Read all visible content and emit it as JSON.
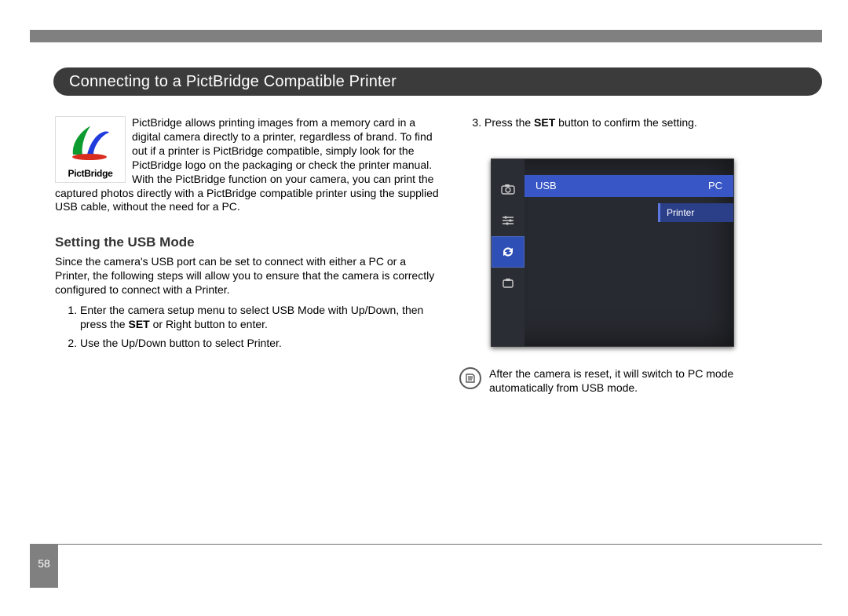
{
  "page_title": "Connecting to a PictBridge Compatible Printer",
  "pictbridge_label": "PictBridge",
  "intro": "PictBridge allows printing images from a memory card in a digital camera directly to a printer, regardless of brand. To find out if a printer is PictBridge compatible, simply look for the PictBridge logo on the packaging or check the printer manual. With the PictBridge function on your camera, you can print the captured photos directly with a PictBridge compatible printer using the supplied USB cable, without the need for a PC.",
  "sub_heading": "Setting the USB Mode",
  "sub_intro": "Since the camera's USB port can be set to connect with either a PC or a Printer, the following steps will allow you to ensure that the camera is correctly configured to connect with a Printer.",
  "steps": {
    "s1a": "Enter the camera setup menu to select USB Mode with Up/Down, then press the ",
    "s1_set": "SET",
    "s1b": " or Right button to enter.",
    "s2": "Use the Up/Down button to select Printer.",
    "s3a": "Press the ",
    "s3_set": "SET",
    "s3b": " button to confirm the setting."
  },
  "lcd": {
    "menu_label": "USB",
    "menu_value": "PC",
    "option_label": "Printer"
  },
  "note_text": "After the camera is reset, it will switch to PC mode automatically from USB mode.",
  "page_number": "58"
}
